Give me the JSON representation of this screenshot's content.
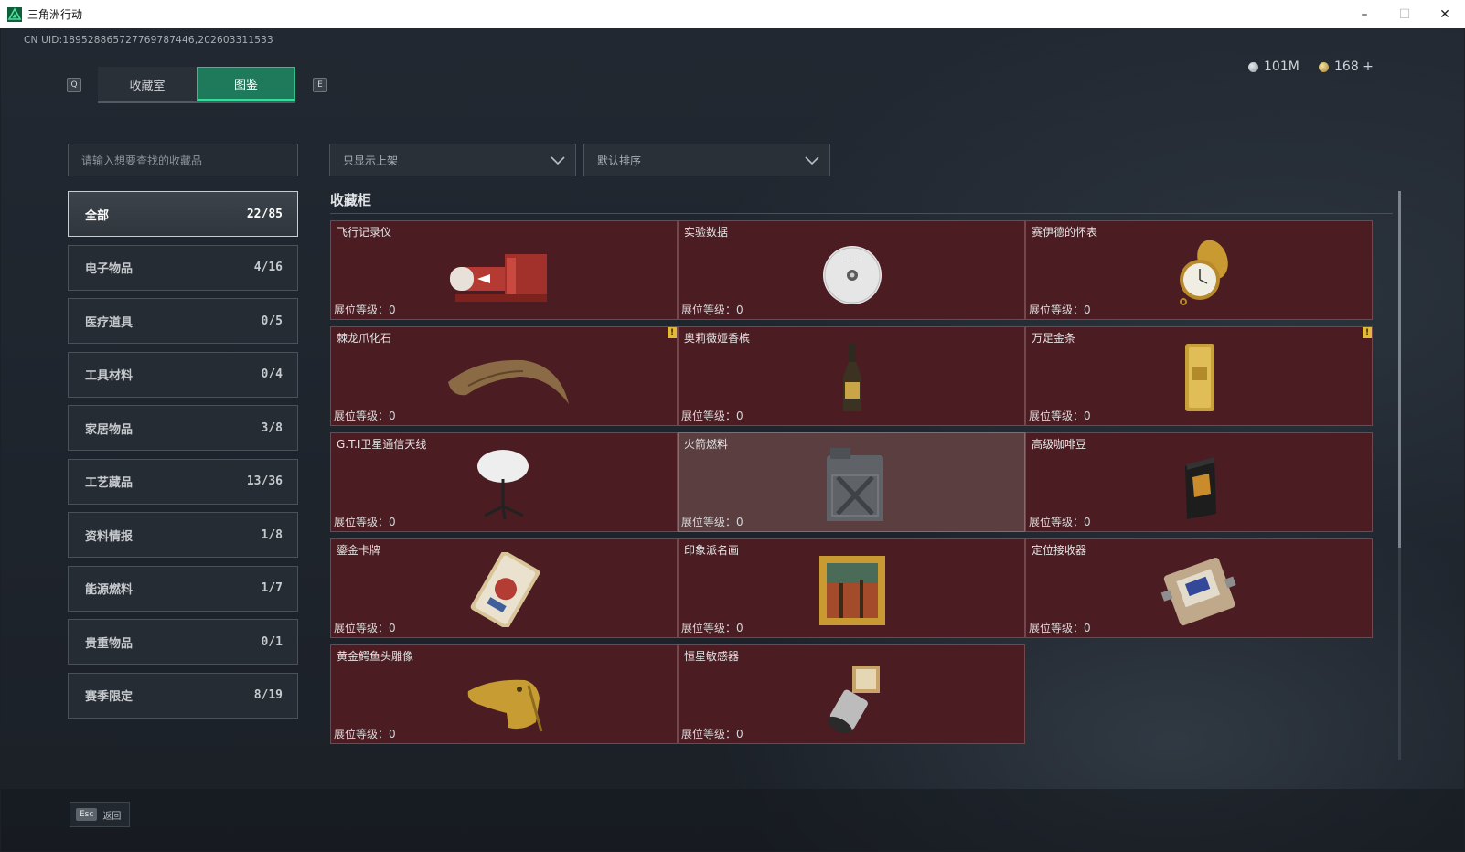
{
  "window": {
    "title": "三角洲行动",
    "minimize": "–",
    "maximize": "☐",
    "close": "✕"
  },
  "uid": "CN UID:1895288657277697874​46,202603311533",
  "keys": {
    "left": "Q",
    "right": "E"
  },
  "tabs": [
    {
      "label": "收藏室"
    },
    {
      "label": "图鉴"
    }
  ],
  "currency": {
    "silver": "101M",
    "gold": "168 +"
  },
  "search": {
    "placeholder": "请输入想要查找的收藏品"
  },
  "filters": {
    "display": "只显示上架",
    "sort": "默认排序"
  },
  "categories": [
    {
      "label": "全部",
      "count": "22/85"
    },
    {
      "label": "电子物品",
      "count": "4/16"
    },
    {
      "label": "医疗道具",
      "count": "0/5"
    },
    {
      "label": "工具材料",
      "count": "0/4"
    },
    {
      "label": "家居物品",
      "count": "3/8"
    },
    {
      "label": "工艺藏品",
      "count": "13/36"
    },
    {
      "label": "资料情报",
      "count": "1/8"
    },
    {
      "label": "能源燃料",
      "count": "1/7"
    },
    {
      "label": "贵重物品",
      "count": "0/1"
    },
    {
      "label": "赛季限定",
      "count": "8/19"
    }
  ],
  "section": {
    "title": "收藏柜"
  },
  "level_label": "展位等级：",
  "items": [
    {
      "name": "飞行记录仪",
      "level": "0",
      "icon": "flight-recorder-icon"
    },
    {
      "name": "实验数据",
      "level": "0",
      "icon": "disc-icon"
    },
    {
      "name": "赛伊德的怀表",
      "level": "0",
      "icon": "pocket-watch-icon"
    },
    {
      "name": "棘龙爪化石",
      "level": "0",
      "icon": "claw-fossil-icon",
      "badge": "!"
    },
    {
      "name": "奥莉薇娅香槟",
      "level": "0",
      "icon": "champagne-icon"
    },
    {
      "name": "万足金条",
      "level": "0",
      "icon": "gold-bar-icon",
      "badge": "!"
    },
    {
      "name": "G.T.I卫星通信天线",
      "level": "0",
      "icon": "satellite-antenna-icon"
    },
    {
      "name": "火箭燃料",
      "level": "0",
      "icon": "fuel-can-icon"
    },
    {
      "name": "高级咖啡豆",
      "level": "0",
      "icon": "coffee-bag-icon"
    },
    {
      "name": "鎏金卡牌",
      "level": "0",
      "icon": "gilded-card-icon"
    },
    {
      "name": "印象派名画",
      "level": "0",
      "icon": "painting-icon"
    },
    {
      "name": "定位接收器",
      "level": "0",
      "icon": "receiver-icon"
    },
    {
      "name": "黄金鳄鱼头雕像",
      "level": "0",
      "icon": "croc-statue-icon"
    },
    {
      "name": "恒星敏感器",
      "level": "0",
      "icon": "star-sensor-icon"
    }
  ],
  "footer": {
    "key": "Esc",
    "label": "返回"
  },
  "colors": {
    "accent": "#2fbf8a",
    "card_bg": "#4b1c22",
    "card_border": "#74474c",
    "badge": "#e2b93b"
  }
}
